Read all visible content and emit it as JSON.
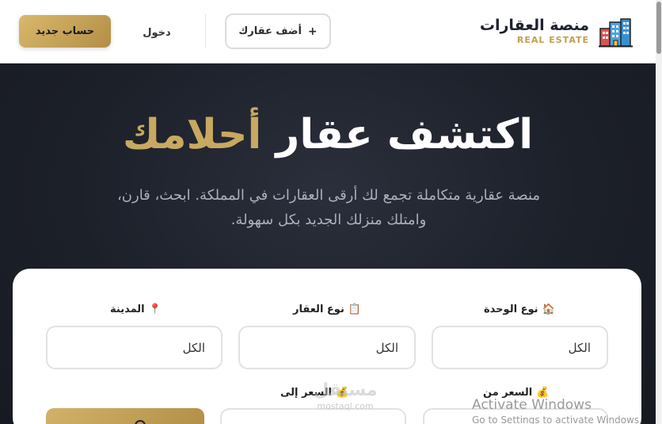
{
  "header": {
    "brand_ar": "منصة العقارات",
    "brand_en": "REAL ESTATE",
    "add_property": "أضف عقارك",
    "add_icon": "+",
    "login": "دخول",
    "register": "حساب جديد"
  },
  "hero": {
    "title_main": "اكتشف عقار",
    "title_accent": "أحلامك",
    "subtitle_line1": "منصة عقارية متكاملة تجمع لك أرقى العقارات في المملكة. ابحث، قارن،",
    "subtitle_line2": "وامتلك منزلك الجديد بكل سهولة."
  },
  "search": {
    "unit_type": {
      "label": "نوع الوحدة",
      "icon": "house-icon",
      "glyph": "🏠",
      "value": "الكل"
    },
    "property_type": {
      "label": "نوع العقار",
      "icon": "clipboard-icon",
      "glyph": "📋",
      "value": "الكل"
    },
    "city": {
      "label": "المدينة",
      "icon": "pin-icon",
      "glyph": "📍",
      "value": "الكل"
    },
    "price_from": {
      "label": "السعر من",
      "icon": "money-bag-icon",
      "glyph": "💰"
    },
    "price_to": {
      "label": "السعر إلى",
      "icon": "money-bag-icon",
      "glyph": "💰"
    }
  },
  "watermark": {
    "line1": "مستقل",
    "line2": "mostaql.com"
  },
  "os_notice": {
    "line1": "Activate Windows",
    "line2": "Go to Settings to activate Windows."
  },
  "colors": {
    "gold": "#c8a960",
    "dark": "#1c2029",
    "brand_text": "#1e2230"
  }
}
